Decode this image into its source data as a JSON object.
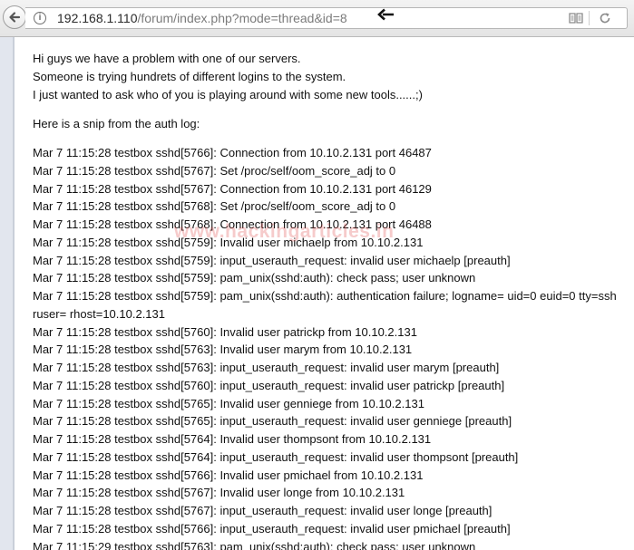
{
  "browser": {
    "url_host": "192.168.1.110",
    "url_path": "/forum/index.php?mode=thread&id=8"
  },
  "post": {
    "intro_lines": [
      "Hi guys we have a problem with one of our servers.",
      "Someone is trying hundrets of different logins to the system.",
      "I just wanted to ask who of you is playing around with some new tools......;)"
    ],
    "snip_intro": "Here is a snip from the auth log:",
    "log_lines": [
      "Mar 7 11:15:28 testbox sshd[5766]: Connection from 10.10.2.131 port 46487",
      "Mar 7 11:15:28 testbox sshd[5767]: Set /proc/self/oom_score_adj to 0",
      "Mar 7 11:15:28 testbox sshd[5767]: Connection from 10.10.2.131 port 46129",
      "Mar 7 11:15:28 testbox sshd[5768]: Set /proc/self/oom_score_adj to 0",
      "Mar 7 11:15:28 testbox sshd[5768]: Connection from 10.10.2.131 port 46488",
      "Mar 7 11:15:28 testbox sshd[5759]: Invalid user michaelp from 10.10.2.131",
      "Mar 7 11:15:28 testbox sshd[5759]: input_userauth_request: invalid user michaelp [preauth]",
      "Mar 7 11:15:28 testbox sshd[5759]: pam_unix(sshd:auth): check pass; user unknown",
      "Mar 7 11:15:28 testbox sshd[5759]: pam_unix(sshd:auth): authentication failure; logname= uid=0 euid=0 tty=ssh ruser= rhost=10.10.2.131",
      "Mar 7 11:15:28 testbox sshd[5760]: Invalid user patrickp from 10.10.2.131",
      "Mar 7 11:15:28 testbox sshd[5763]: Invalid user marym from 10.10.2.131",
      "Mar 7 11:15:28 testbox sshd[5763]: input_userauth_request: invalid user marym [preauth]",
      "Mar 7 11:15:28 testbox sshd[5760]: input_userauth_request: invalid user patrickp [preauth]",
      "Mar 7 11:15:28 testbox sshd[5765]: Invalid user genniege from 10.10.2.131",
      "Mar 7 11:15:28 testbox sshd[5765]: input_userauth_request: invalid user genniege [preauth]",
      "Mar 7 11:15:28 testbox sshd[5764]: Invalid user thompsont from 10.10.2.131",
      "Mar 7 11:15:28 testbox sshd[5764]: input_userauth_request: invalid user thompsont [preauth]",
      "Mar 7 11:15:28 testbox sshd[5766]: Invalid user pmichael from 10.10.2.131",
      "Mar 7 11:15:28 testbox sshd[5767]: Invalid user longe from 10.10.2.131",
      "Mar 7 11:15:28 testbox sshd[5767]: input_userauth_request: invalid user longe [preauth]",
      "Mar 7 11:15:28 testbox sshd[5766]: input_userauth_request: invalid user pmichael [preauth]",
      "Mar 7 11:15:29 testbox sshd[5763]: pam_unix(sshd:auth): check pass; user unknown"
    ],
    "watermark": "www.hackingarticles.in"
  },
  "icons": {
    "back": "arrow-left-icon",
    "info": "info-icon",
    "pointer": "pointing-arrow-icon",
    "reader": "reader-view-icon",
    "reload": "reload-icon"
  },
  "colors": {
    "watermark": "#e04646",
    "gutter": "#e2e6ee"
  }
}
